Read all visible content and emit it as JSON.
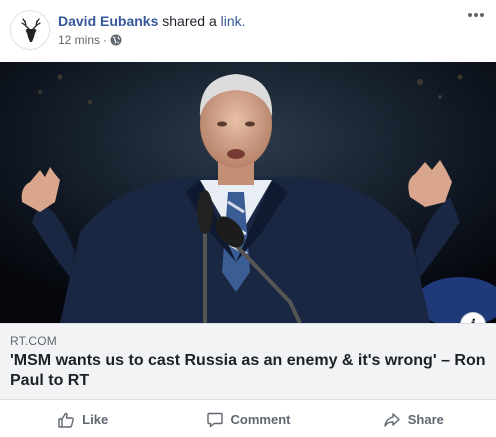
{
  "post": {
    "author": "David Eubanks",
    "action_text": "shared a",
    "action_link": "link.",
    "timestamp": "12 mins",
    "separator": "·",
    "privacy_icon": "globe-icon",
    "more_icon": "more-options-icon"
  },
  "link_preview": {
    "domain": "RT.COM",
    "headline": "'MSM wants us to cast Russia as an enemy & it's wrong' – Ron Paul to RT",
    "info_label": "i"
  },
  "actions": {
    "like": "Like",
    "comment": "Comment",
    "share": "Share"
  },
  "colors": {
    "link_blue": "#365899",
    "meta_gray": "#616770",
    "preview_bg": "#f2f3f5"
  }
}
